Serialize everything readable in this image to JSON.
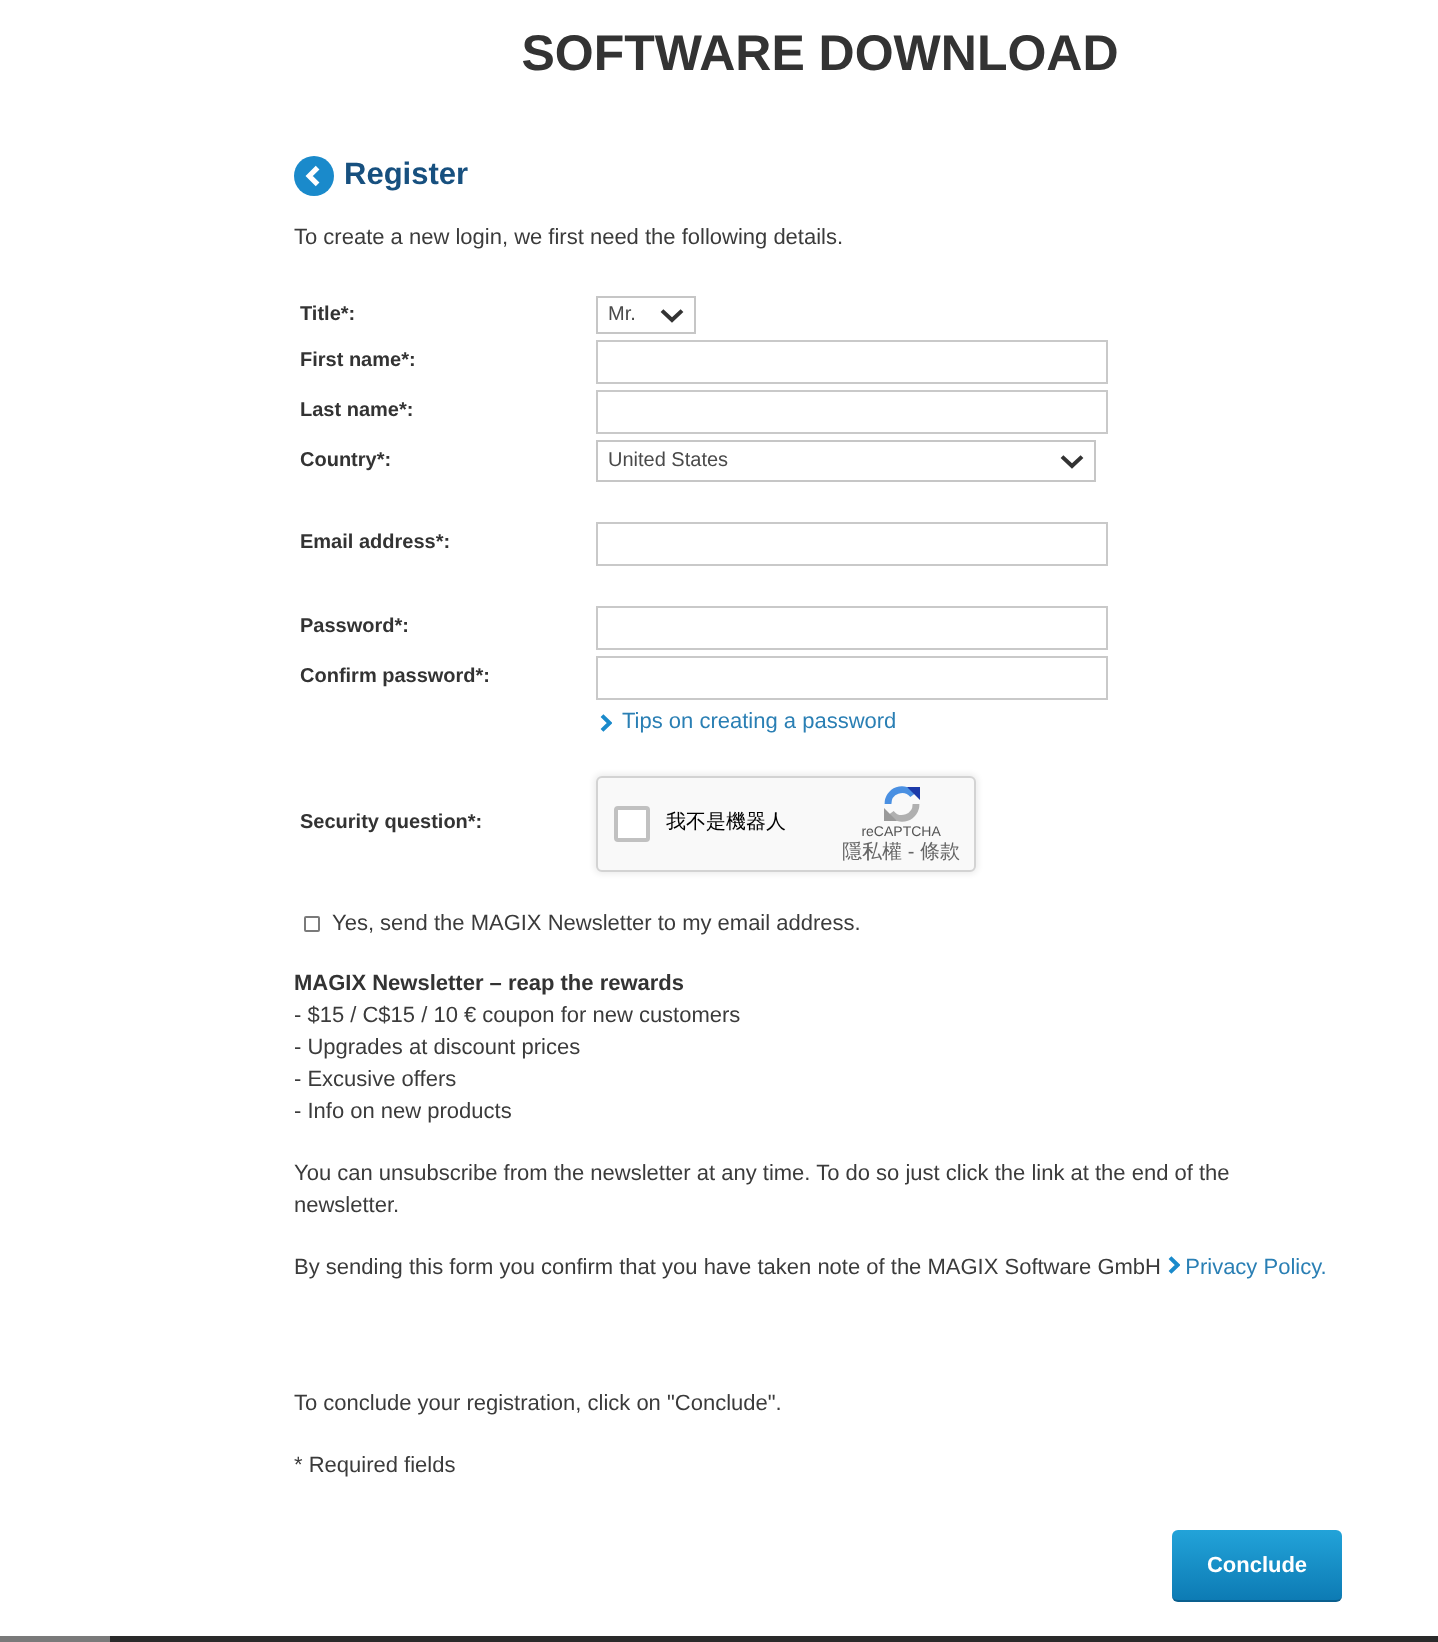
{
  "page_title": "SOFTWARE DOWNLOAD",
  "header": {
    "title": "Register",
    "intro": "To create a new login, we first need the following details."
  },
  "form_groups": [
    {
      "fields": [
        {
          "kind": "dropdown",
          "label": "Title*:",
          "value": "Mr."
        },
        {
          "kind": "text",
          "label": "First name*:"
        },
        {
          "kind": "text",
          "label": "Last name*:"
        },
        {
          "kind": "select",
          "label": "Country*:",
          "value": "United States"
        }
      ]
    },
    {
      "fields": [
        {
          "kind": "text",
          "label": "Email address*:"
        }
      ]
    },
    {
      "fields": [
        {
          "kind": "password",
          "label": "Password*:"
        },
        {
          "kind": "password",
          "label": "Confirm password*:",
          "link": "Tips on creating a password"
        }
      ]
    },
    {
      "fields": [
        {
          "kind": "captcha",
          "label": "Security question*:",
          "captcha": {
            "checked": false,
            "label": "我不是機器人",
            "brand": "reCAPTCHA",
            "links": "隱私權 - 條款"
          }
        }
      ]
    }
  ],
  "newsletter": {
    "checked": false,
    "label": "Yes, send the MAGIX Newsletter to my email address."
  },
  "benefits": {
    "title": "MAGIX Newsletter – reap the rewards",
    "items": [
      "- $15 / C$15 / 10 € coupon for new customers",
      "- Upgrades at discount prices",
      "- Excusive offers",
      "- Info on new products"
    ]
  },
  "unsubscribe_note": "You can unsubscribe from the newsletter at any time. To do so just click the link at the end of the newsletter.",
  "privacy_note": {
    "text": "By sending this form you confirm that you have taken note of the MAGIX Software GmbH",
    "link": "Privacy Policy."
  },
  "conclude_note": "To conclude your registration, click on \"Conclude\".",
  "required_note": "* Required fields",
  "submit_button": "Conclude"
}
